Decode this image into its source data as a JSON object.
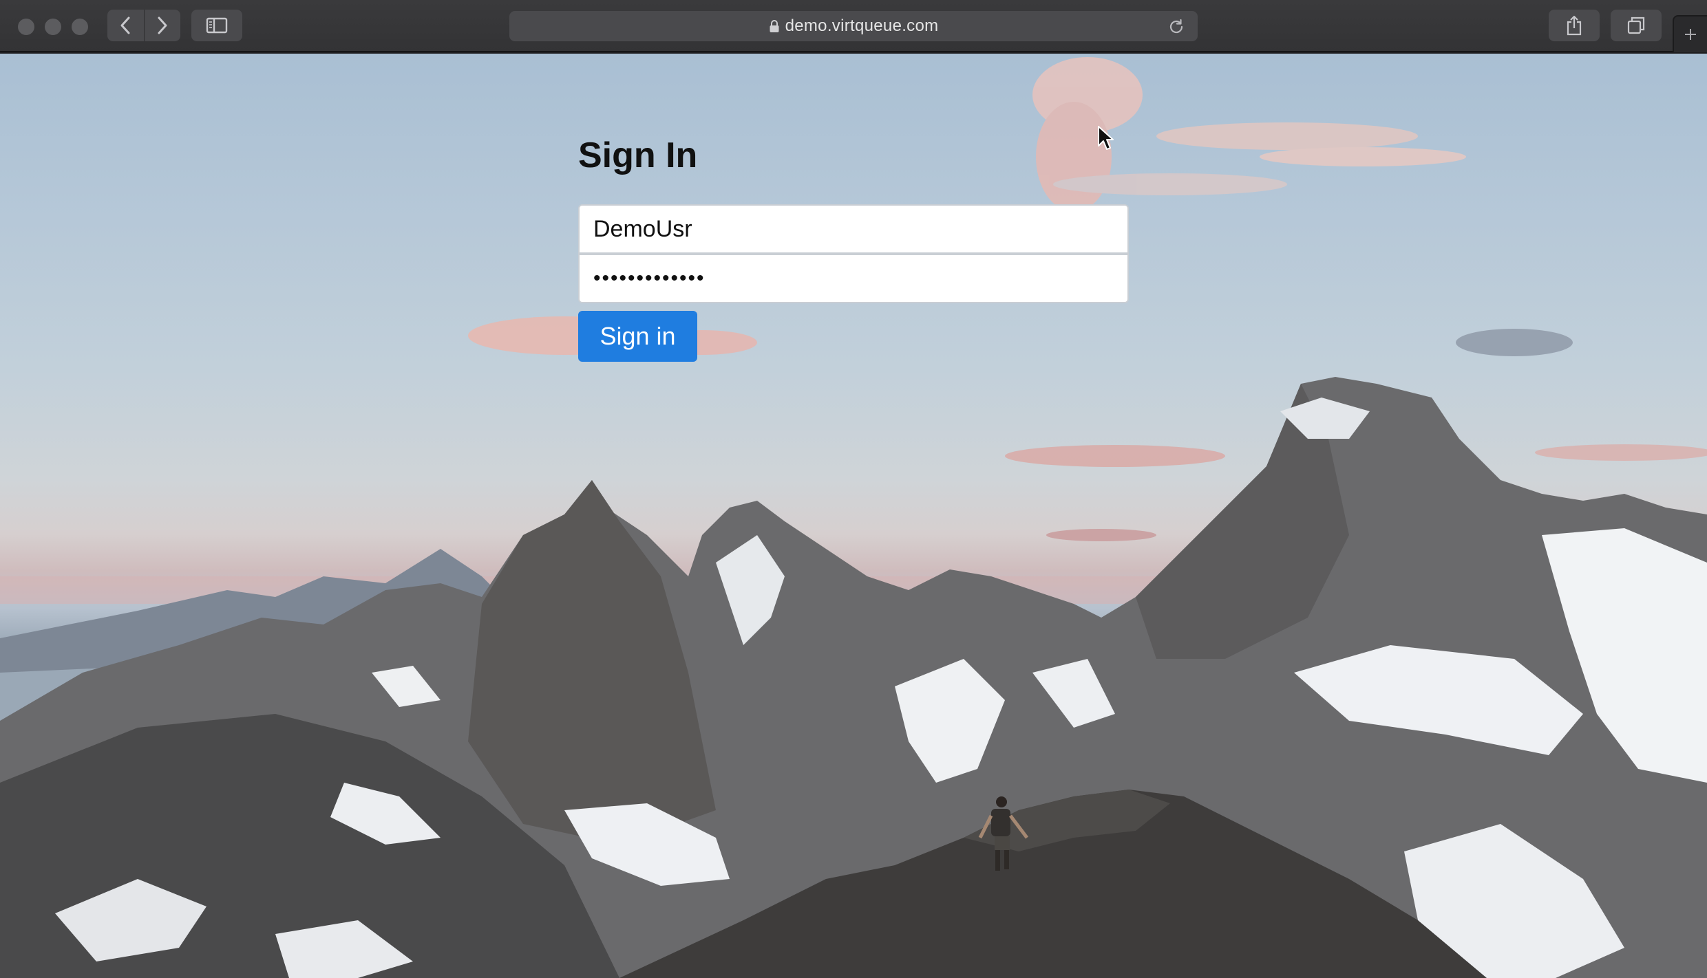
{
  "browser": {
    "url": "demo.virtqueue.com"
  },
  "page": {
    "title": "Sign In",
    "username_value": "DemoUsr",
    "password_value": "•••••••••••••",
    "submit_label": "Sign in"
  },
  "colors": {
    "primary_button": "#1f7de0",
    "chrome": "#3a3a3c"
  },
  "icons": [
    "back-arrow-icon",
    "forward-arrow-icon",
    "sidebar-icon",
    "lock-icon",
    "reload-icon",
    "share-icon",
    "tabs-overview-icon",
    "plus-icon",
    "mouse-pointer-icon"
  ]
}
